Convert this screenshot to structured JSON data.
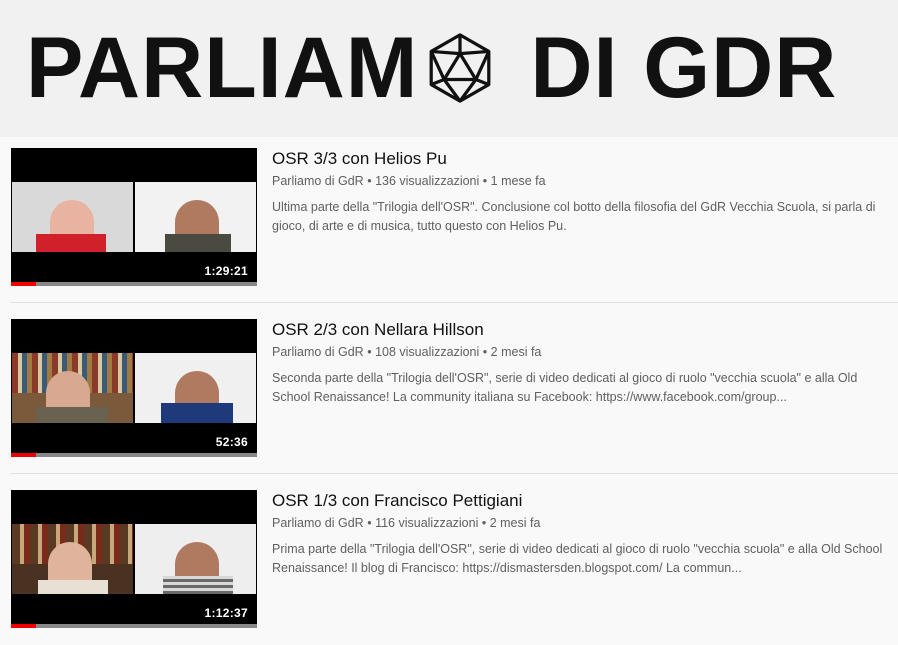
{
  "header": {
    "logo_left": "PARLIAM",
    "logo_right": "DI GDR",
    "logo_icon": "d20-icon"
  },
  "videos": [
    {
      "title": "OSR 3/3 con Helios Pu",
      "channel": "Parliamo di GdR",
      "views": "136 visualizzazioni",
      "age": "1 mese fa",
      "description": "Ultima parte della \"Trilogia dell'OSR\". Conclusione col botto della filosofia del GdR Vecchia Scuola, si parla di gioco, di arte e di musica, tutto questo con Helios Pu.",
      "duration": "1:29:21",
      "watched_fraction": 0.1
    },
    {
      "title": "OSR 2/3 con Nellara Hillson",
      "channel": "Parliamo di GdR",
      "views": "108 visualizzazioni",
      "age": "2 mesi fa",
      "description": "Seconda parte della \"Trilogia dell'OSR\", serie di video dedicati al gioco di ruolo \"vecchia scuola\" e alla Old School Renaissance! La community italiana su Facebook: https://www.facebook.com/group...",
      "duration": "52:36",
      "watched_fraction": 0.1
    },
    {
      "title": "OSR 1/3 con Francisco Pettigiani",
      "channel": "Parliamo di GdR",
      "views": "116 visualizzazioni",
      "age": "2 mesi fa",
      "description": "Prima parte della \"Trilogia dell'OSR\", serie di video dedicati al gioco di ruolo \"vecchia scuola\" e alla Old School Renaissance! Il blog di Francisco: https://dismastersden.blogspot.com/ La commun...",
      "duration": "1:12:37",
      "watched_fraction": 0.1
    }
  ],
  "separator": "•",
  "colors": {
    "progress": "#e00000",
    "text_primary": "#111111",
    "text_secondary": "#606060"
  }
}
